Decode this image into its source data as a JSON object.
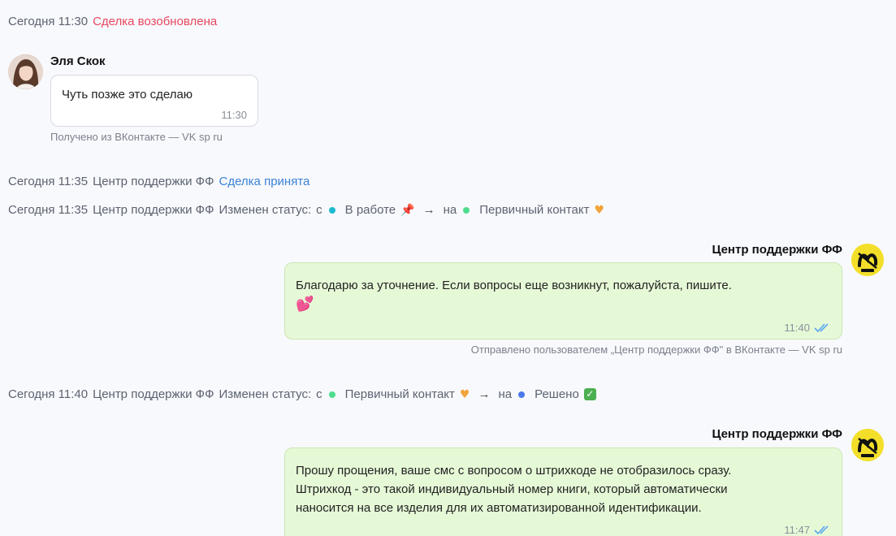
{
  "events": [
    {
      "time": "Сегодня 11:30",
      "text": "Сделка возобновлена"
    },
    {
      "time": "Сегодня 11:35",
      "author": "Центр поддержки ФФ",
      "text": "Сделка принята"
    },
    {
      "time": "Сегодня 11:35",
      "author": "Центр поддержки ФФ",
      "text": "Изменен статус:",
      "from_word": "с",
      "from_status": "В работе",
      "to_word": "на",
      "to_status": "Первичный контакт"
    },
    {
      "time": "Сегодня 11:40",
      "author": "Центр поддержки ФФ",
      "text": "Изменен статус:",
      "from_word": "с",
      "from_status": "Первичный контакт",
      "to_word": "на",
      "to_status": "Решено"
    }
  ],
  "status_colors": {
    "В работе": "#1fb8d0",
    "Первичный контакт": "#4fdc8f",
    "Решено": "#4d79e8"
  },
  "messages": [
    {
      "sender": "Эля Скок",
      "text": "Чуть позже это сделаю",
      "time": "11:30",
      "meta": "Получено из ВКонтакте — VK sp ru"
    },
    {
      "sender": "Центр поддержки ФФ",
      "text_lines": [
        "Благодарю за уточнение. Если вопросы еще возникнут, пожалуйста, пишите."
      ],
      "emoji": "💕",
      "time": "11:40",
      "meta": "Отправлено пользователем „Центр поддержки ФФ\" в ВКонтакте — VK sp ru"
    },
    {
      "sender": "Центр поддержки ФФ",
      "text_lines": [
        "Прошу прощения, ваше смс с вопросом о штрихкоде не отобразилось сразу.",
        "Штрихкод  - это такой индивидуальный номер книги, который автоматически",
        "наносится на все изделия для их автоматизированной идентификации."
      ],
      "time": "11:47"
    }
  ]
}
